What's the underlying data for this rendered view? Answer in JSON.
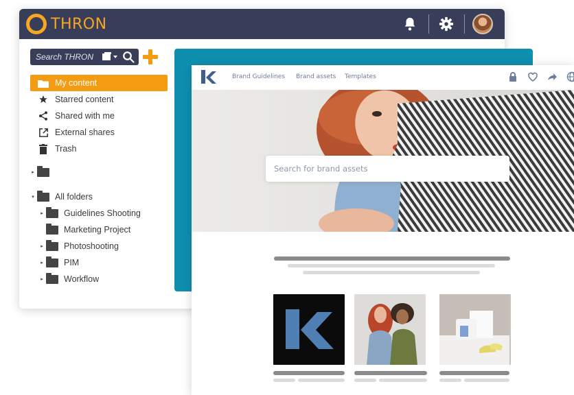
{
  "thron": {
    "logo_text": "THRON",
    "search_placeholder": "Search THRON",
    "nav_items": [
      {
        "label": "My content",
        "icon": "folder-icon"
      },
      {
        "label": "Starred content",
        "icon": "star-icon"
      },
      {
        "label": "Shared with me",
        "icon": "share-icon"
      },
      {
        "label": "External shares",
        "icon": "external-link-icon"
      },
      {
        "label": "Trash",
        "icon": "trash-icon"
      }
    ],
    "all_folders_label": "All folders",
    "folders": [
      {
        "label": "Guidelines Shooting"
      },
      {
        "label": "Marketing Project"
      },
      {
        "label": "Photoshooting"
      },
      {
        "label": "PIM"
      },
      {
        "label": "Workflow"
      }
    ],
    "colors": {
      "header": "#383d5a",
      "accent": "#f39c12"
    }
  },
  "portal": {
    "nav_links": [
      "Brand Guidelines",
      "Brand assets",
      "Templates"
    ],
    "search_placeholder": "Search for brand assets",
    "colors": {
      "teal_panel": "#0f8fb0",
      "logo": "#3f5f8f"
    }
  }
}
